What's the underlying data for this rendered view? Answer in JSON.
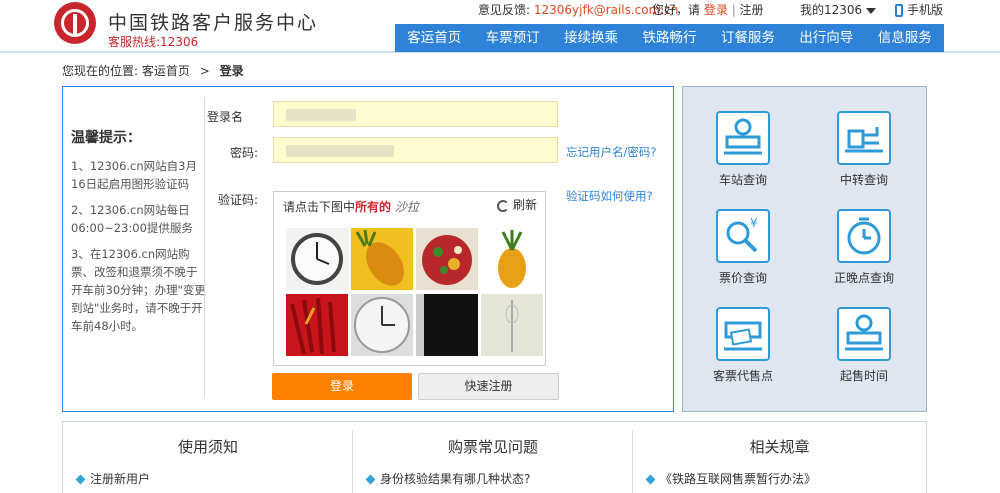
{
  "header": {
    "brand": "中国铁路客户服务中心",
    "hotline": "客服热线:12306",
    "feedback_label": "意见反馈:",
    "feedback_email": "12306yjfk@rails.com.cn",
    "greeting": "您好，请",
    "login_link": "登录",
    "register_link": "注册",
    "my12306": "我的12306",
    "mobile": "手机版"
  },
  "nav": [
    "客运首页",
    "车票预订",
    "接续换乘",
    "铁路畅行",
    "订餐服务",
    "出行向导",
    "信息服务"
  ],
  "breadcrumb": {
    "prefix": "您现在的位置:",
    "home": "客运首页",
    "sep": ">",
    "current": "登录"
  },
  "tips": {
    "title": "温馨提示：",
    "items": [
      "1、12306.cn网站自3月16日起启用图形验证码",
      "2、12306.cn网站每日06:00~23:00提供服务",
      "3、在12306.cn网站购票、改签和退票须不晚于开车前30分钟；办理\"变更到站\"业务时，请不晚于开车前48小时。"
    ]
  },
  "form": {
    "username_label": "登录名",
    "password_label": "密码:",
    "captcha_label": "验证码:",
    "forgot": "忘记用户名/密码?",
    "captcha_help": "验证码如何使用?",
    "captcha_prompt_a": "请点击下图中",
    "captcha_prompt_b": "所有的",
    "captcha_target": "沙拉",
    "refresh": "刷新",
    "login_btn": "登录",
    "register_btn": "快速注册"
  },
  "quick": [
    {
      "label": "车站查询",
      "icon": "station-icon"
    },
    {
      "label": "中转查询",
      "icon": "transfer-icon"
    },
    {
      "label": "票价查询",
      "icon": "price-search-icon"
    },
    {
      "label": "正晚点查询",
      "icon": "clock-icon"
    },
    {
      "label": "客票代售点",
      "icon": "ticket-agency-icon"
    },
    {
      "label": "起售时间",
      "icon": "station-icon"
    }
  ],
  "bottom": [
    {
      "title": "使用须知",
      "item": "注册新用户"
    },
    {
      "title": "购票常见问题",
      "item": "身份核验结果有哪几种状态?"
    },
    {
      "title": "相关规章",
      "item": "《铁路互联网售票暂行办法》"
    }
  ],
  "colors": {
    "nav_blue": "#2e82d7",
    "brand_red": "#c8252c",
    "login_orange": "#ff8000",
    "input_yellow": "#fdfccf"
  }
}
